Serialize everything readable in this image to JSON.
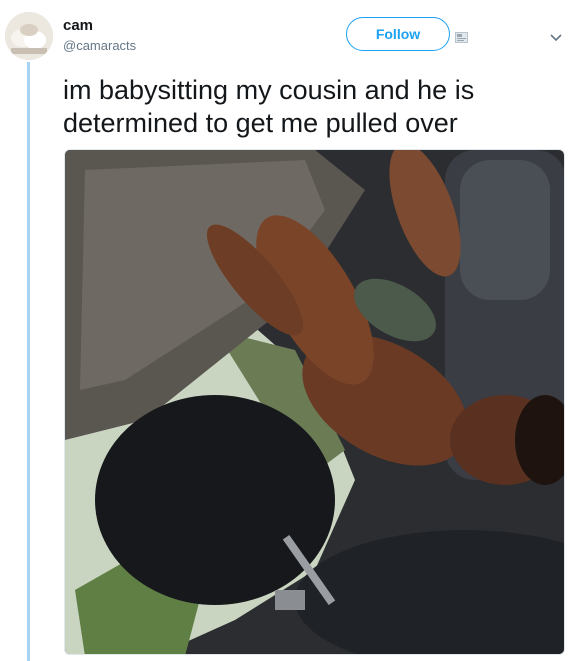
{
  "tweet": {
    "author_name": "cam",
    "author_handle": "@camaracts",
    "follow_label": "Follow",
    "text_line_1": "im babysitting my cousin and he is",
    "text_line_2": "determined to get me pulled over",
    "icons": [
      "avatar",
      "direct-message-icon",
      "chevron-down-icon"
    ]
  },
  "colors": {
    "accent": "#1da1f2",
    "thread_line": "#a6d4f2",
    "text": "#14171a",
    "secondary_text": "#657786"
  }
}
